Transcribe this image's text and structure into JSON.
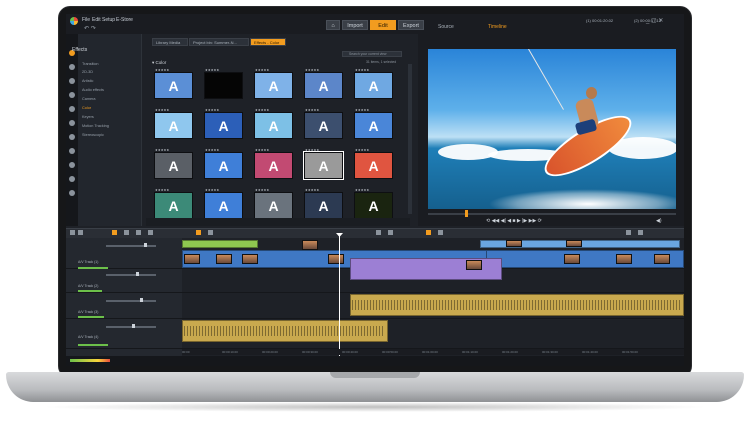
{
  "menubar": {
    "items": [
      "File",
      "Edit",
      "Setup",
      "E-Store"
    ],
    "undo_glyph": "↶ ↷",
    "nav": {
      "home_glyph": "⌂",
      "import": "Import",
      "edit": "Edit",
      "export": "Export"
    },
    "window_controls": "_  ▢  ✕"
  },
  "categories": {
    "title": "Effects",
    "items": [
      "Transition",
      "2D-3D",
      "Artistic",
      "Audio effects",
      "Camera",
      "Color",
      "Keyers",
      "Motion Tracking",
      "Stereoscopic"
    ],
    "active_index": 5
  },
  "library": {
    "tabs": [
      "Library Media",
      "Project bin: Summer-N...",
      "Effects - Color"
    ],
    "active_tab": 2,
    "search_placeholder": "Search your current view",
    "section_title": "▾ Color",
    "count": "31 items, 1 selected",
    "tiles": [
      {
        "glyph": "A",
        "color": "#5b8fd6"
      },
      {
        "glyph": "",
        "color": "#050505"
      },
      {
        "glyph": "A",
        "color": "#7fb2e8"
      },
      {
        "glyph": "A",
        "color": "#5c86c9"
      },
      {
        "glyph": "A",
        "color": "#6fa8e2"
      },
      {
        "glyph": "A",
        "color": "#8fc7ee"
      },
      {
        "glyph": "A",
        "color": "#2c5fb8"
      },
      {
        "glyph": "A",
        "color": "#7dc0e6"
      },
      {
        "glyph": "A",
        "color": "#3c4f6e"
      },
      {
        "glyph": "A",
        "color": "#4a86d8"
      },
      {
        "glyph": "A",
        "color": "#5a5f66"
      },
      {
        "glyph": "A",
        "color": "#3f7fd8"
      },
      {
        "glyph": "A",
        "color": "#c24a72"
      },
      {
        "glyph": "A",
        "color": "#9a9a9a"
      },
      {
        "glyph": "A",
        "color": "#e05540"
      },
      {
        "glyph": "A",
        "color": "#3c8a78"
      },
      {
        "glyph": "A",
        "color": "#3f7fd8"
      },
      {
        "glyph": "A",
        "color": "#6a737d"
      },
      {
        "glyph": "A",
        "color": "#2c3a52"
      },
      {
        "glyph": "A",
        "color": "#1a2410"
      }
    ],
    "tile_stars": "★★★★★"
  },
  "preview": {
    "tabs": [
      "Source",
      "Timeline"
    ],
    "active_tab": 1,
    "timecode_left": "(1) 00:01:20.02",
    "timecode_right": "(2) 00:00:17.13",
    "transport_glyphs": "⟲  ◀◀  ◀|  ◀  ■  ▶  |▶  ▶▶  ⟳",
    "volume_glyph": "◀)"
  },
  "timeline": {
    "tracks": [
      "A/V Track (1)",
      "A/V Track (2)",
      "A/V Track (3)",
      "A/V Track (4)"
    ],
    "ruler_labels": [
      "00:00",
      "00:00:10.00",
      "00:00:20.00",
      "00:00:30.00",
      "00:00:40.00",
      "00:00:50.00",
      "00:01:00.00",
      "00:01:10.00",
      "00:01:20.00",
      "00:01:30.00",
      "00:01:40.00",
      "00:01:50.00"
    ]
  }
}
